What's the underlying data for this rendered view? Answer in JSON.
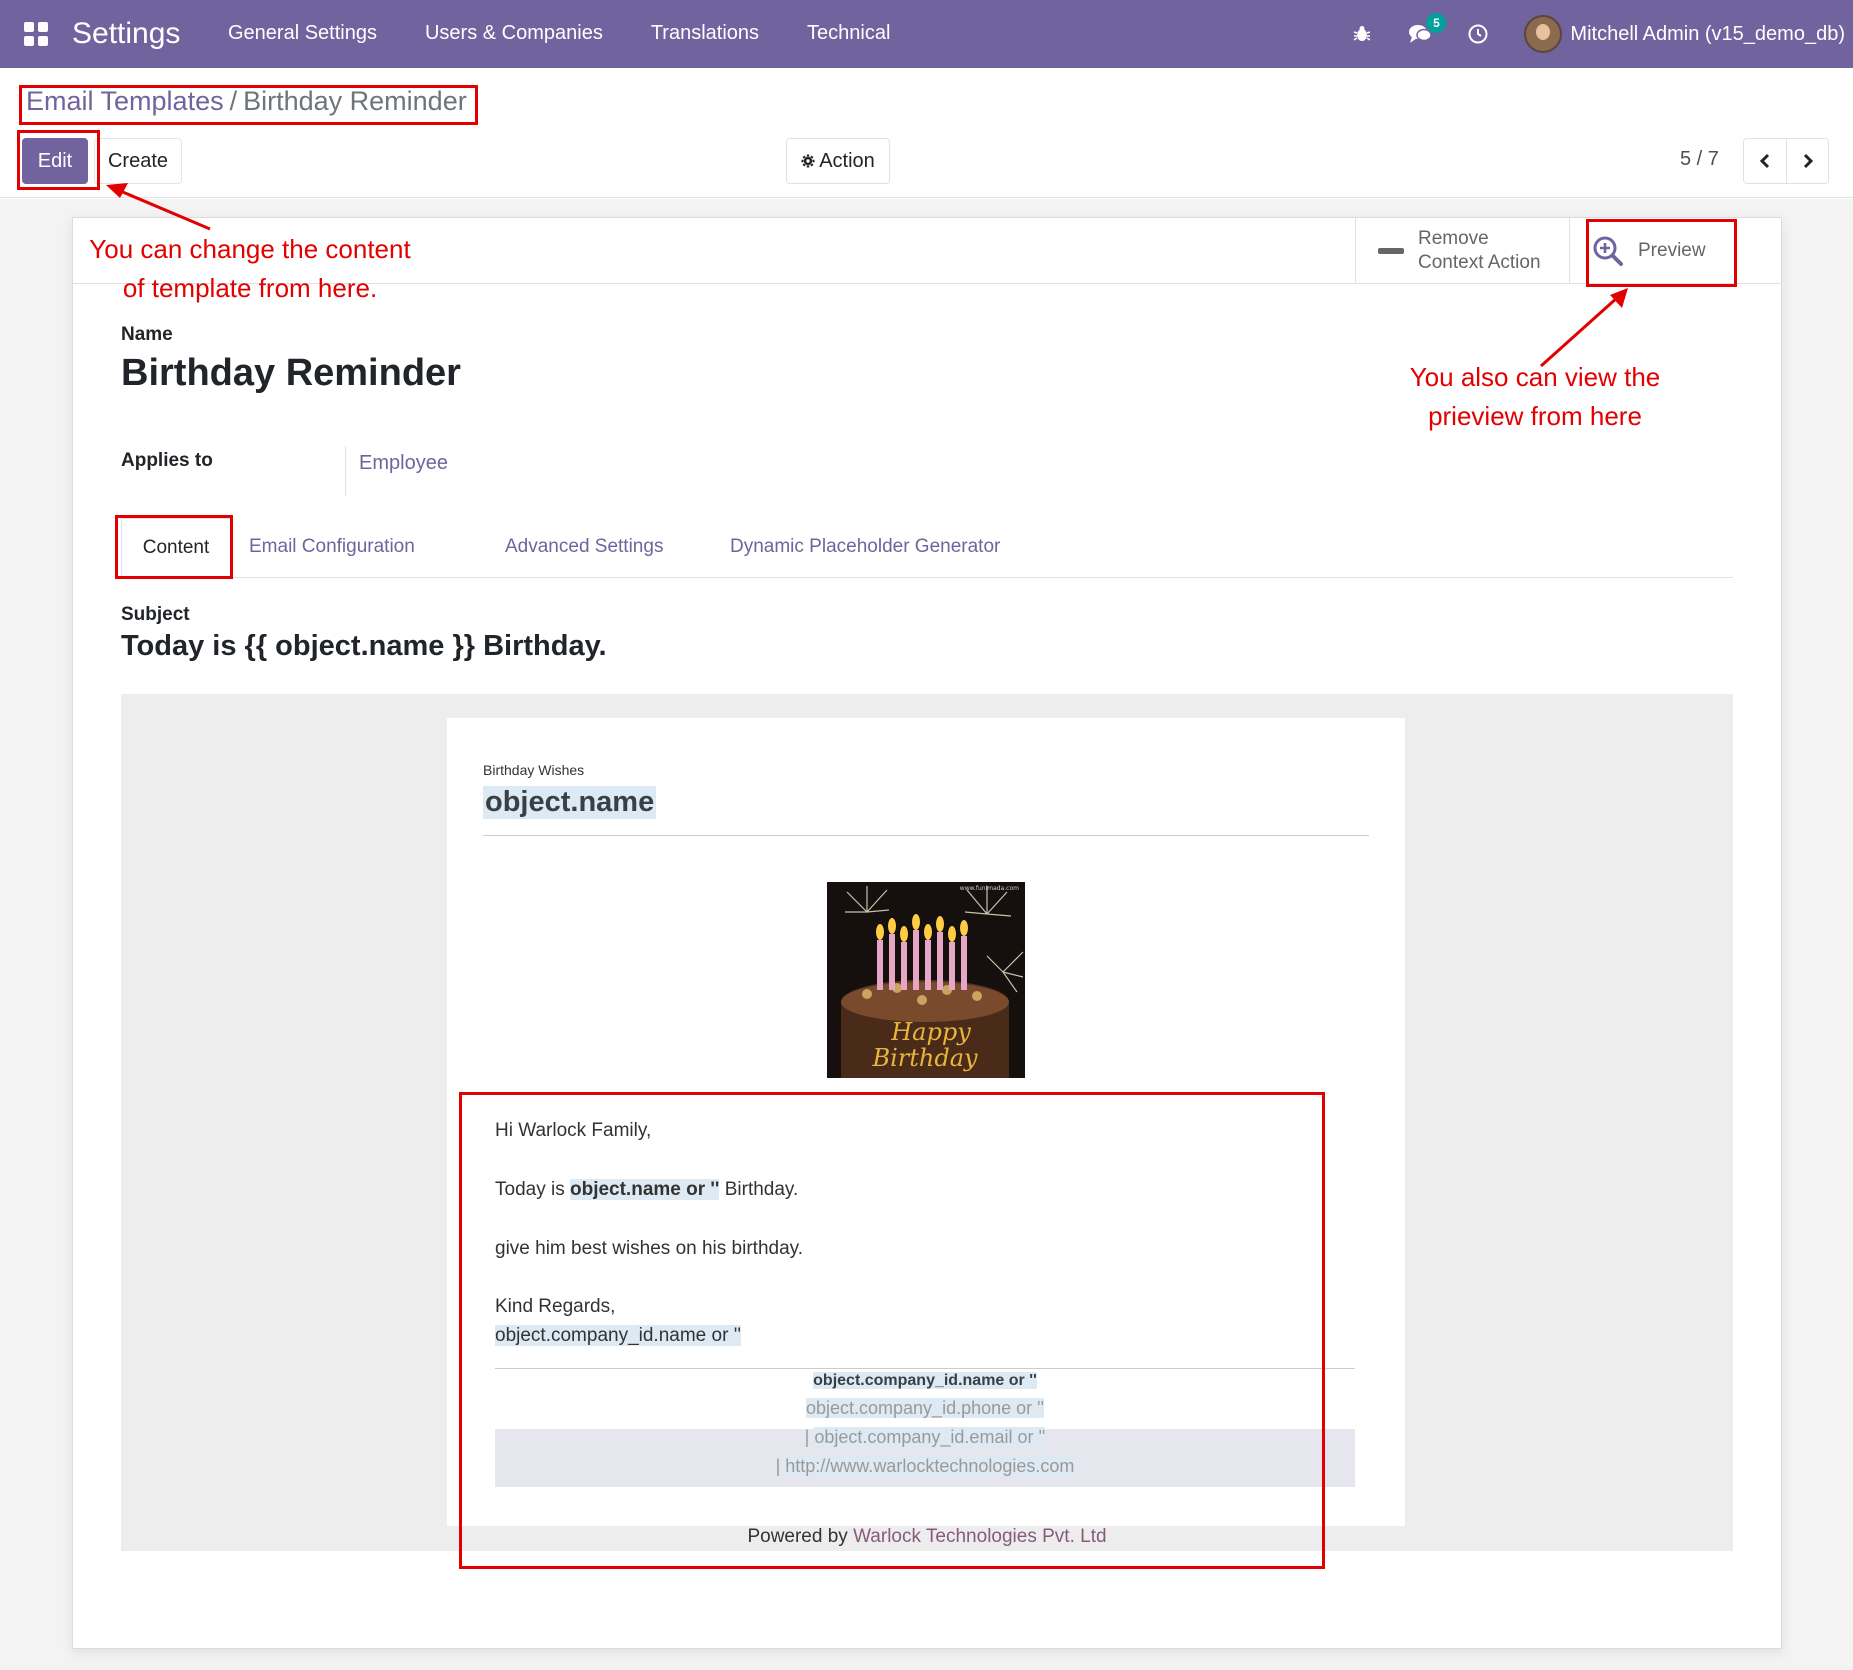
{
  "navbar": {
    "app_title": "Settings",
    "menu": [
      "General Settings",
      "Users & Companies",
      "Translations",
      "Technical"
    ],
    "messages_count": "5",
    "user_name": "Mitchell Admin (v15_demo_db)",
    "background": "#71639e"
  },
  "control_panel": {
    "breadcrumb_parent": "Email Templates",
    "breadcrumb_separator": "/",
    "breadcrumb_current": "Birthday Reminder",
    "edit_label": "Edit",
    "create_label": "Create",
    "action_label": "Action",
    "pager_value": "5 / 7"
  },
  "button_box": {
    "remove_line1": "Remove",
    "remove_line2": "Context Action",
    "preview_label": "Preview"
  },
  "form": {
    "name_label": "Name",
    "name_value": "Birthday Reminder",
    "applies_label": "Applies to",
    "applies_value": "Employee",
    "tabs": [
      "Content",
      "Email Configuration",
      "Advanced Settings",
      "Dynamic Placeholder Generator"
    ],
    "subject_label": "Subject",
    "subject_value": "Today is {{ object.name }} Birthday."
  },
  "email_body": {
    "kicker": "Birthday Wishes",
    "title": "object.name",
    "greeting": "Hi Warlock Family,",
    "today_prefix": "Today is ",
    "today_placeholder": "object.name or ''",
    "today_suffix": " Birthday.",
    "wishes": "give him best wishes on his birthday.",
    "regards": "Kind Regards,",
    "signature": "object.company_id.name or ''",
    "footer_company": "object.company_id.name or ''",
    "footer_phone": "object.company_id.phone or ''",
    "footer_email_prefix": "| ",
    "footer_email": "object.company_id.email or ''",
    "footer_web_prefix": "| ",
    "footer_web": "http://www.warlocktechnologies.com",
    "powered_prefix": "Powered by ",
    "powered_link": "Warlock Technologies Pvt. Ltd",
    "cake_text_line1": "Happy",
    "cake_text_line2": "Birthday",
    "cake_watermark": "www.funimada.com"
  },
  "annotations": {
    "edit_note_line1": "You can change the content",
    "edit_note_line2": "of template from here.",
    "preview_note_line1": "You also can view the",
    "preview_note_line2": "prieview from here",
    "color": "#e30000"
  }
}
